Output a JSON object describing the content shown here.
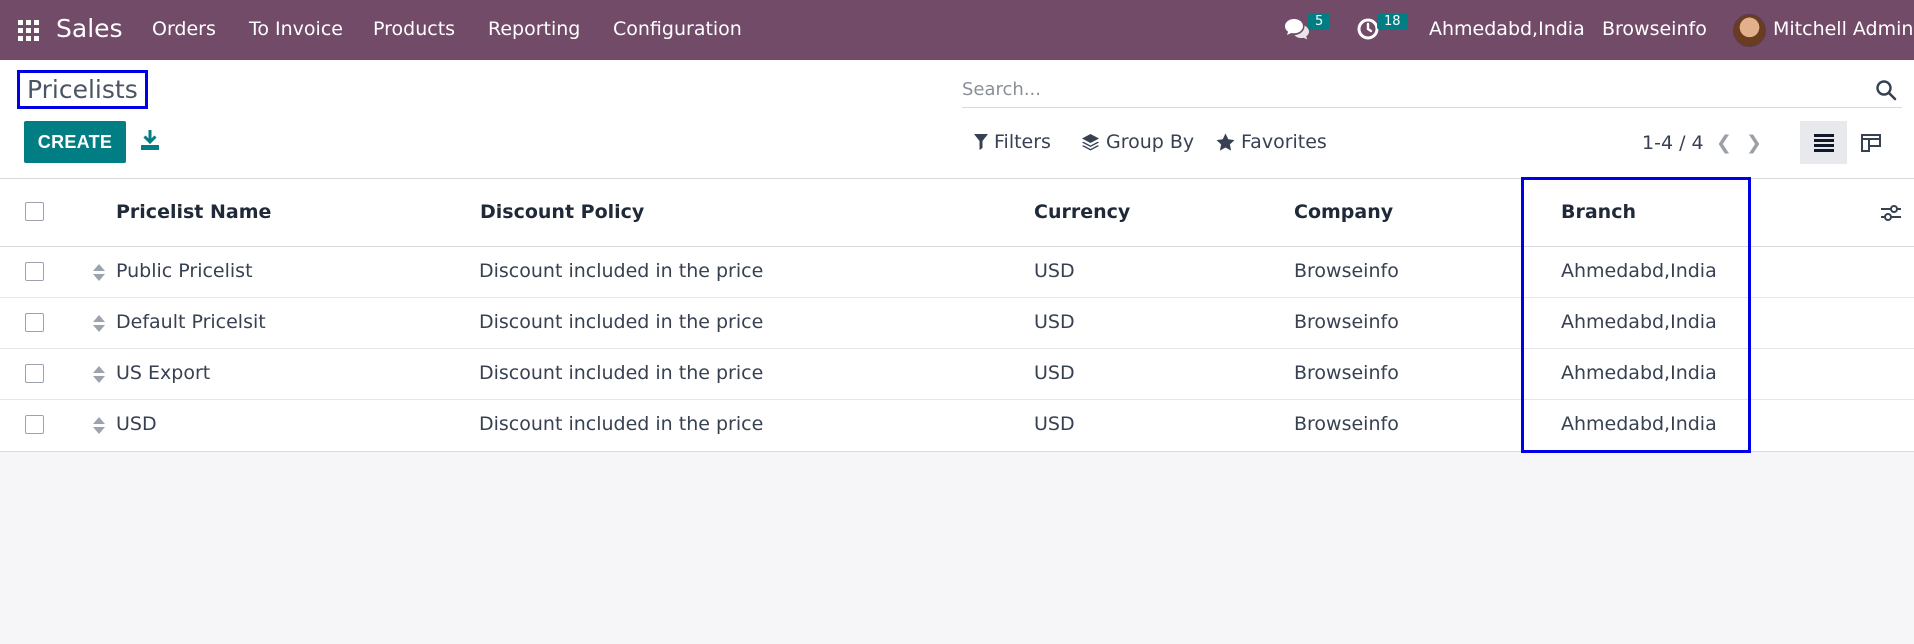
{
  "navbar": {
    "brand": "Sales",
    "menu": [
      "Orders",
      "To Invoice",
      "Products",
      "Reporting",
      "Configuration"
    ],
    "messages_count": "5",
    "activities_count": "18",
    "branch": "Ahmedabd,India",
    "company": "Browseinfo",
    "user": "Mitchell Admin",
    "icons": {
      "apps": "apps-grid-icon",
      "messages": "chat-bubbles-icon",
      "activities": "clock-icon"
    }
  },
  "control_panel": {
    "title": "Pricelists",
    "create_label": "CREATE",
    "search_placeholder": "Search...",
    "filters_label": "Filters",
    "group_by_label": "Group By",
    "favorites_label": "Favorites",
    "pager": "1-4 / 4"
  },
  "table": {
    "columns": [
      "Pricelist Name",
      "Discount Policy",
      "Currency",
      "Company",
      "Branch"
    ],
    "rows": [
      [
        "Public Pricelist",
        "Discount included in the price",
        "USD",
        "Browseinfo",
        "Ahmedabd,India"
      ],
      [
        "Default Pricelsit",
        "Discount included in the price",
        "USD",
        "Browseinfo",
        "Ahmedabd,India"
      ],
      [
        "US Export",
        "Discount included in the price",
        "USD",
        "Browseinfo",
        "Ahmedabd,India"
      ],
      [
        "USD",
        "Discount included in the price",
        "USD",
        "Browseinfo",
        "Ahmedabd,India"
      ]
    ]
  },
  "colors": {
    "navbar": "#714b67",
    "primary": "#017e84",
    "highlight": "#0000e6"
  }
}
